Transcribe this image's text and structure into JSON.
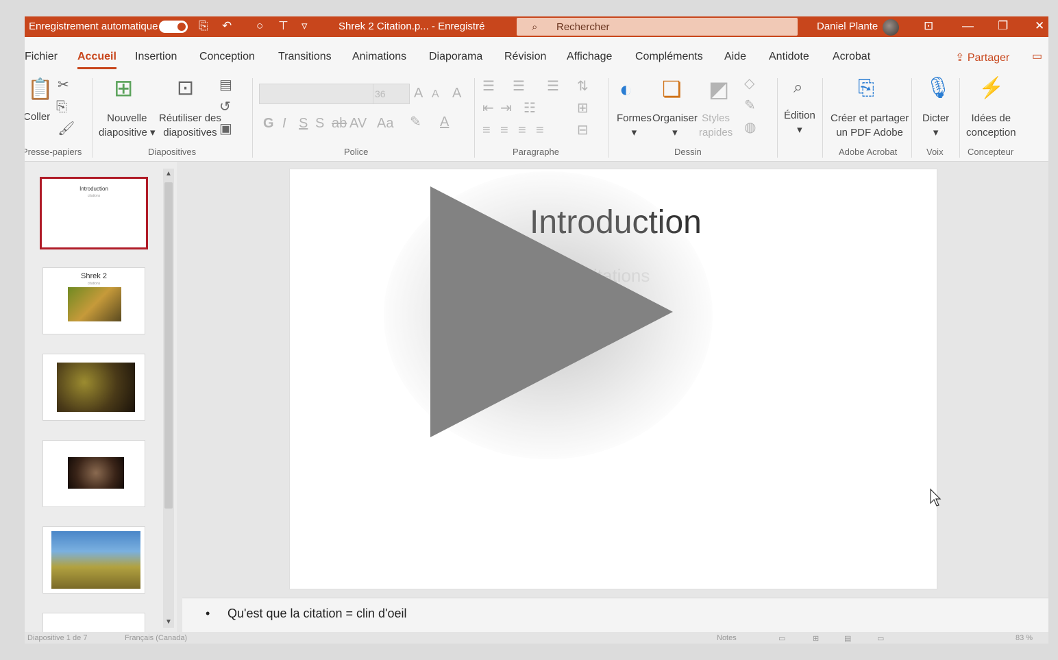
{
  "titlebar": {
    "autosave_label": "Enregistrement automatique",
    "doc_name": "Shrek 2 Citation.p... - Enregistré",
    "search_placeholder": "Rechercher",
    "user_name": "Daniel Plante",
    "bg_color": "#c8461c"
  },
  "tabs": [
    {
      "label": "Fichier"
    },
    {
      "label": "Accueil",
      "active": true
    },
    {
      "label": "Insertion"
    },
    {
      "label": "Conception"
    },
    {
      "label": "Transitions"
    },
    {
      "label": "Animations"
    },
    {
      "label": "Diaporama"
    },
    {
      "label": "Révision"
    },
    {
      "label": "Affichage"
    },
    {
      "label": "Compléments"
    },
    {
      "label": "Aide"
    },
    {
      "label": "Antidote"
    },
    {
      "label": "Acrobat"
    }
  ],
  "share_label": "Partager",
  "ribbon": {
    "coller": "Coller",
    "nouvelle_1": "Nouvelle",
    "nouvelle_2": "diapositive",
    "reutiliser_1": "Réutiliser des",
    "reutiliser_2": "diapositives",
    "font_size": "36",
    "formes": "Formes",
    "organiser": "Organiser",
    "styles_1": "Styles",
    "styles_2": "rapides",
    "edition": "Édition",
    "pdf_1": "Créer et partager",
    "pdf_2": "un PDF Adobe",
    "dicter": "Dicter",
    "idees_1": "Idées de",
    "idees_2": "conception",
    "groups": {
      "presse": "Presse-papiers",
      "diapositives": "Diapositives",
      "police": "Police",
      "paragraphe": "Paragraphe",
      "dessin": "Dessin",
      "acrobat": "Adobe Acrobat",
      "voix": "Voix",
      "concepteur": "Concepteur"
    }
  },
  "thumbnails": [
    {
      "title": "Introduction",
      "subtitle": "citations",
      "selected": true
    },
    {
      "title": "Shrek 2",
      "subtitle": "citations"
    },
    {
      "title": ""
    },
    {
      "title": ""
    },
    {
      "title": ""
    }
  ],
  "slide": {
    "title": "Introduction",
    "subtitle": "citations"
  },
  "notes": "Qu'est que la citation = clin d'oeil",
  "statusbar": {
    "slide_count": "Diapositive 1 de 7",
    "language": "Français (Canada)",
    "notes_label": "Notes",
    "zoom": "83 %"
  },
  "colors": {
    "accent": "#c8461c",
    "selection": "#b01c28",
    "play_triangle": "#828282"
  }
}
